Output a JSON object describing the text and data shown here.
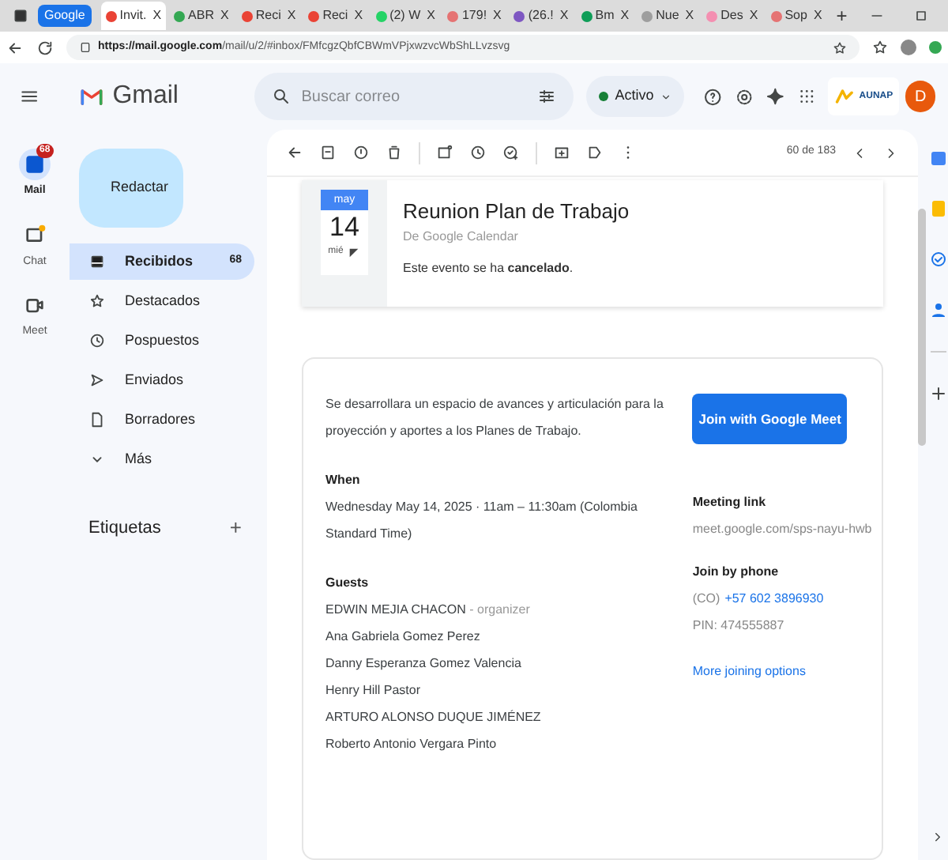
{
  "browser": {
    "tabs": [
      {
        "label": "Invit.",
        "selected": true,
        "color": "#ea4335",
        "close": "X"
      },
      {
        "label": "ABR",
        "selected": false,
        "color": "#34a853",
        "close": "X"
      },
      {
        "label": "Reci",
        "selected": false,
        "color": "#ea4335",
        "close": "X"
      },
      {
        "label": "Reci",
        "selected": false,
        "color": "#ea4335",
        "close": "X"
      },
      {
        "label": "(2) W",
        "selected": false,
        "color": "#25d366",
        "close": "X"
      },
      {
        "label": "179!",
        "selected": false,
        "color": "#e57373",
        "close": "X"
      },
      {
        "label": "(26.!",
        "selected": false,
        "color": "#7e57c2",
        "close": "X"
      },
      {
        "label": "Bm",
        "selected": false,
        "color": "#0f9d58",
        "close": "X"
      },
      {
        "label": "Nue",
        "selected": false,
        "color": "#9e9e9e",
        "close": "X"
      },
      {
        "label": "Des",
        "selected": false,
        "color": "#f48fb1",
        "close": "X"
      },
      {
        "label": "Sop",
        "selected": false,
        "color": "#e57373",
        "close": "X"
      }
    ],
    "group_label": "Google",
    "new_tab": "+",
    "url_host": "https://mail.google.com",
    "url_path": "/mail/u/2/#inbox/FMfcgzQbfCBWmVPjxwzvcWbShLLvzsvg"
  },
  "header": {
    "logo": "Gmail",
    "search": {
      "placeholder": "Buscar correo"
    },
    "status": "Activo",
    "org_logo": "AUNAP",
    "avatar": "D"
  },
  "rail": [
    {
      "label": "Mail",
      "badge": "68",
      "selected": true
    },
    {
      "label": "Chat",
      "selected": false
    },
    {
      "label": "Meet",
      "selected": false
    }
  ],
  "compose": "Redactar",
  "folders": [
    {
      "label": "Recibidos",
      "count": "68",
      "selected": true
    },
    {
      "label": "Destacados",
      "selected": false
    },
    {
      "label": "Pospuestos",
      "selected": false
    },
    {
      "label": "Enviados",
      "selected": false
    },
    {
      "label": "Borradores",
      "selected": false
    },
    {
      "label": "Más",
      "selected": false
    }
  ],
  "labels_heading": "Etiquetas",
  "labels_add": "+",
  "toolbar": {
    "pager": "60 de 183"
  },
  "event": {
    "month": "may",
    "day": "14",
    "weekday": "mié",
    "title": "Reunion Plan de Trabajo",
    "source": "De Google Calendar",
    "notice": "Este evento se ha **cancelado**."
  },
  "invite": {
    "description": "Se desarrollara un espacio de avances y articulación para la proyección y aportes a los Planes de Trabajo.",
    "join_button": "Join with Google Meet",
    "when_heading": "When",
    "when": "Wednesday May 14, 2025 · 11am – 11:30am (Colombia Standard Time)",
    "guests_heading": "Guests",
    "guests": [
      {
        "name": "EDWIN MEJIA CHACON",
        "role": "- organizer"
      },
      {
        "name": "Ana Gabriela Gomez Perez"
      },
      {
        "name": "Danny Esperanza Gomez Valencia"
      },
      {
        "name": "Henry Hill Pastor"
      },
      {
        "name": "ARTURO ALONSO DUQUE JIMÉNEZ"
      },
      {
        "name": "Roberto Antonio Vergara Pinto"
      }
    ],
    "meeting_link_heading": "Meeting link",
    "meeting_link": "meet.google.com/sps-nayu-hwb",
    "phone_heading": "Join by phone",
    "phone_prefix": "(CO)",
    "phone": "+57 602 3896930",
    "pin": "PIN: 474555887",
    "more_options": "More joining options"
  }
}
